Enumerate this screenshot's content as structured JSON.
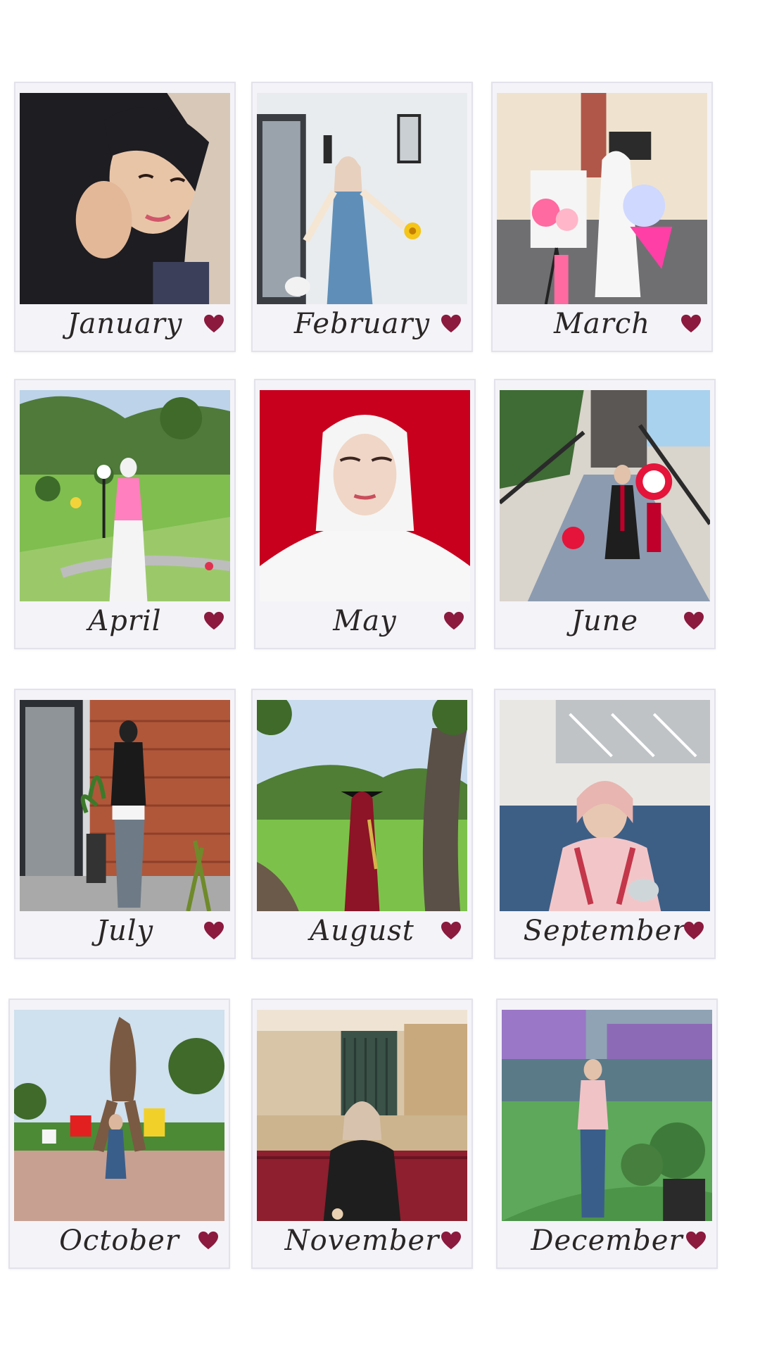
{
  "months": [
    {
      "label": "January"
    },
    {
      "label": "February"
    },
    {
      "label": "March"
    },
    {
      "label": "April"
    },
    {
      "label": "May"
    },
    {
      "label": "June"
    },
    {
      "label": "July"
    },
    {
      "label": "August"
    },
    {
      "label": "September"
    },
    {
      "label": "October"
    },
    {
      "label": "November"
    },
    {
      "label": "December"
    }
  ],
  "colors": {
    "heart": "#8b1a3e",
    "card": "#f4f3f8",
    "may_background": "#c8001e"
  },
  "icons": {
    "heart": "heart-icon"
  }
}
